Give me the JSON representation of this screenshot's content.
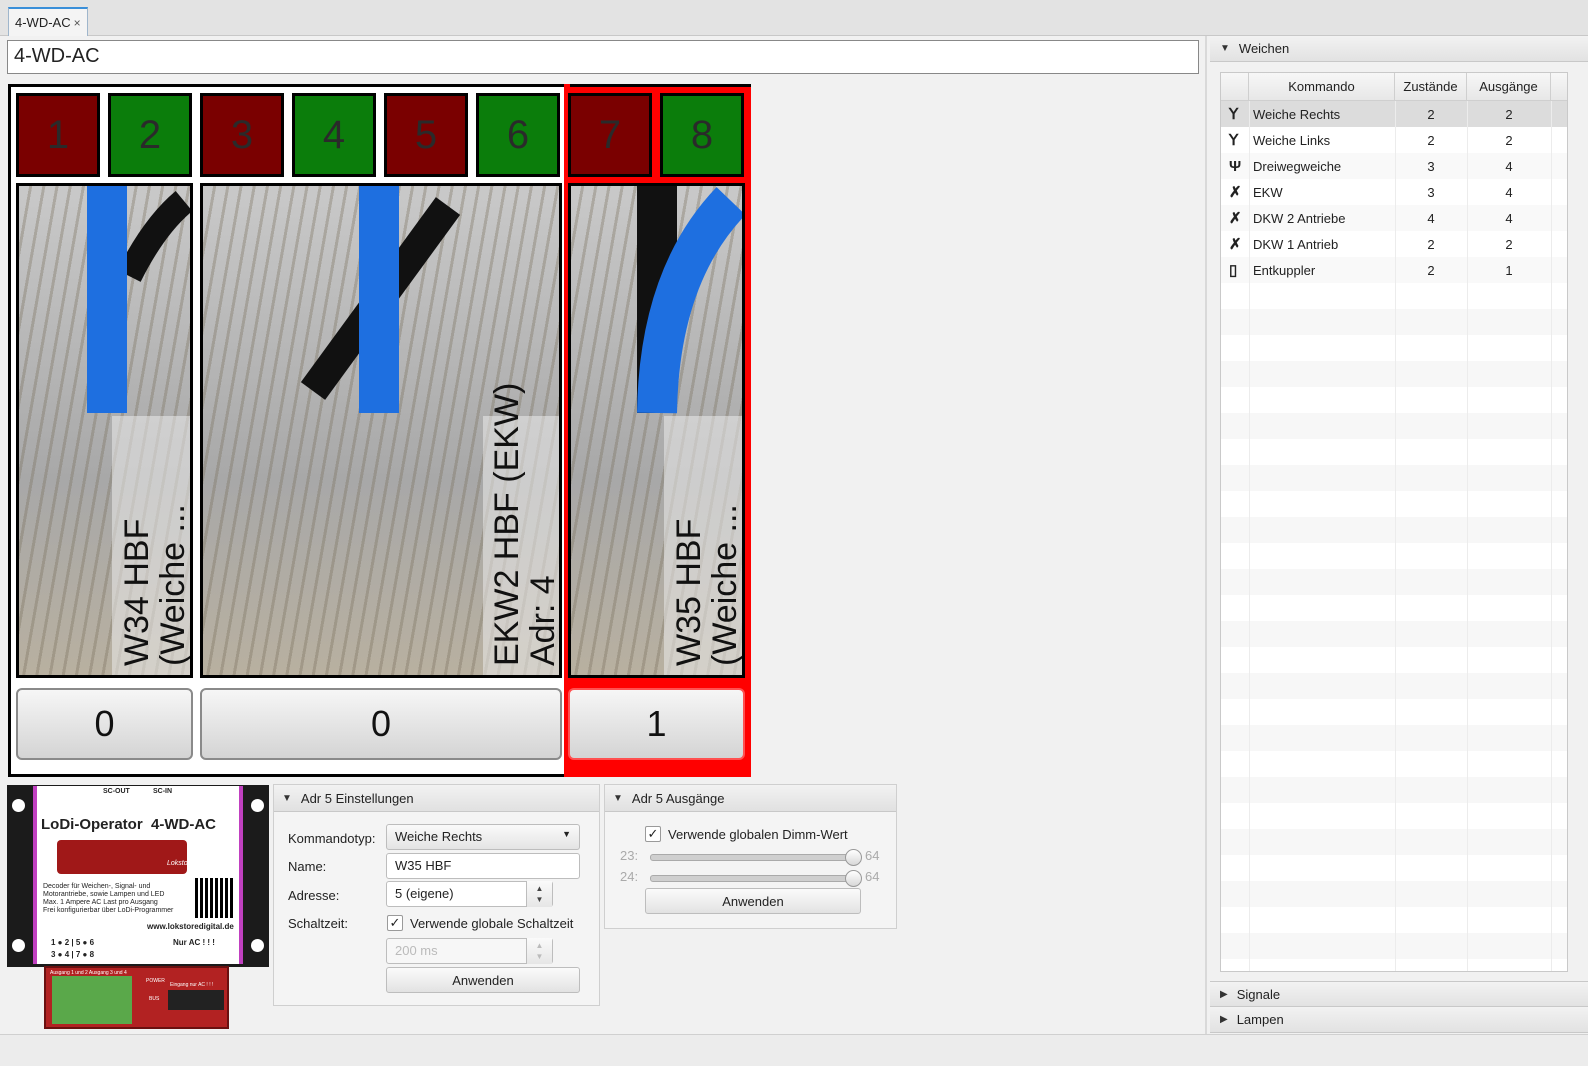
{
  "tab": {
    "label": "4-WD-AC",
    "close": "×"
  },
  "title_field": {
    "value": "4-WD-AC"
  },
  "board": {
    "buttons": [
      {
        "label": "1",
        "color": "#7a0000"
      },
      {
        "label": "2",
        "color": "#0b7d0b"
      },
      {
        "label": "3",
        "color": "#7a0000"
      },
      {
        "label": "4",
        "color": "#0b7d0b"
      },
      {
        "label": "5",
        "color": "#7a0000"
      },
      {
        "label": "6",
        "color": "#0b7d0b"
      },
      {
        "label": "7",
        "color": "#7a0000"
      },
      {
        "label": "8",
        "color": "#0b7d0b"
      }
    ],
    "panels": [
      {
        "line1": "W34 HBF",
        "line2": "(Weiche ...",
        "state": "0"
      },
      {
        "line1": "EKW2 HBF (EKW)",
        "line2": "Adr: 4",
        "state": "0"
      },
      {
        "line1": "W35 HBF",
        "line2": "(Weiche ...",
        "state": "1"
      }
    ],
    "selected_color": "#ff0000",
    "active_color": "#1e6fe0"
  },
  "module": {
    "sc_out": "SC-OUT",
    "sc_in": "SC-IN",
    "title": "LoDi-Operator  4-WD-AC",
    "brand": "Lokstoredigital",
    "features": [
      "Decoder für Weichen-, Signal- und",
      "Motorantriebe, sowie Lampen und LED",
      "Max. 1 Ampere AC Last pro Ausgang",
      "Frei konfigurierbar über LoDi-Programmer"
    ],
    "url": "www.lokstoredigital.de",
    "leds_row1": "1 ● 2 | 5 ● 6",
    "leds_row2": "3 ● 4 | 7 ● 8",
    "nur_ac": "Nur AC ! ! !",
    "terminal_left": "Ausgang 1 und 2   Ausgang 3 und 4",
    "power": "POWER",
    "bus": "BUS",
    "eingang": "Eingang nur AC ! ! !"
  },
  "settings": {
    "header": "Adr 5 Einstellungen",
    "kommandotyp_label": "Kommandotyp:",
    "kommandotyp_value": "Weiche Rechts",
    "name_label": "Name:",
    "name_value": "W35 HBF",
    "adresse_label": "Adresse:",
    "adresse_value": "5 (eigene)",
    "schaltzeit_label": "Schaltzeit:",
    "schaltzeit_checkbox": "Verwende globale Schaltzeit",
    "schaltzeit_value": "200 ms",
    "apply": "Anwenden"
  },
  "outputs": {
    "header": "Adr 5 Ausgänge",
    "dimm_checkbox": "Verwende globalen Dimm-Wert",
    "sliders": [
      {
        "label": "23:",
        "value": "64",
        "fraction": 1.0
      },
      {
        "label": "24:",
        "value": "64",
        "fraction": 1.0
      }
    ],
    "apply": "Anwenden"
  },
  "weichen": {
    "header": "Weichen",
    "columns": [
      "Kommando",
      "Zustände",
      "Ausgänge"
    ],
    "rows": [
      {
        "name": "Weiche Rechts",
        "zustaende": "2",
        "ausgaenge": "2"
      },
      {
        "name": "Weiche Links",
        "zustaende": "2",
        "ausgaenge": "2"
      },
      {
        "name": "Dreiwegweiche",
        "zustaende": "3",
        "ausgaenge": "4"
      },
      {
        "name": "EKW",
        "zustaende": "3",
        "ausgaenge": "4"
      },
      {
        "name": "DKW 2 Antriebe",
        "zustaende": "4",
        "ausgaenge": "4"
      },
      {
        "name": "DKW 1 Antrieb",
        "zustaende": "2",
        "ausgaenge": "2"
      },
      {
        "name": "Entkuppler",
        "zustaende": "2",
        "ausgaenge": "1"
      }
    ]
  },
  "sections": {
    "signale": "Signale",
    "lampen": "Lampen"
  }
}
